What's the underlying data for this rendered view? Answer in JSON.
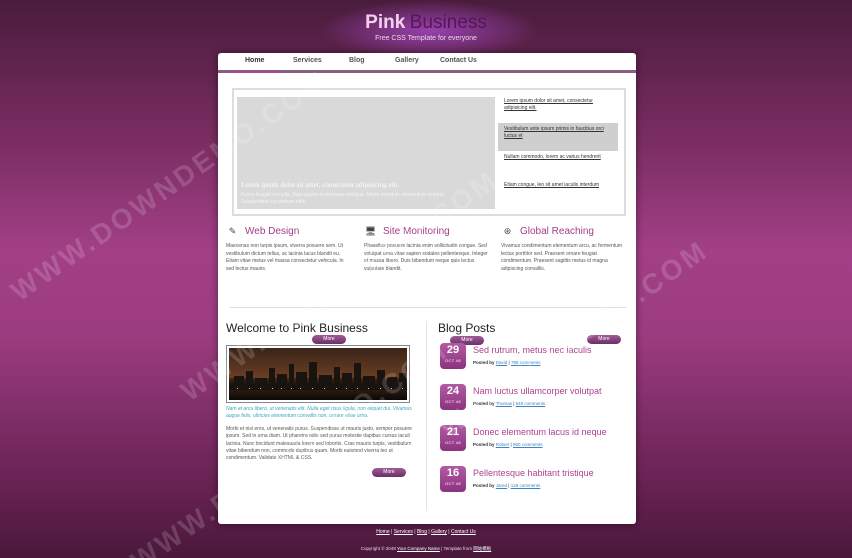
{
  "brand": {
    "part1": "Pink",
    "part2": "Business",
    "tagline": "Free CSS Template for everyone"
  },
  "nav": [
    "Home",
    "Services",
    "Blog",
    "Gallery",
    "Contact Us"
  ],
  "slider": {
    "heading": "Lorem ipsum dolor sit amet, consectetur adipisicing elit.",
    "text": "Fusce feugiat mi nulla. Nam auctor scelerisque tristique. Morbi interdum elementum semper. Suspendisse eu pretium nibh.",
    "links": [
      "Lorem ipsum dolor sit amet, consectetur adipisicing elit.",
      "Vestibulum ante ipsum primis in faucibus orci luctus et",
      "Nullam commodo, lorem ac varius hendrerit",
      "Etiam congue, leo sit amet iaculis interdum"
    ]
  },
  "services": [
    {
      "title": "Web Design",
      "icon": "pencil-icon",
      "text": "Maecenas non turpis ipsum, viverra posuere sem. Ut vestibulum dictum tellus, ac lacinia lacus blandit eu. Etiam vitae metus vel massa consectetur vehicula. In sed lectus mauris."
    },
    {
      "title": "Site Monitoring",
      "icon": "monitor-icon",
      "text": "Phasellus posuere lacinia enim sollicitudin congue. Sed volutpat urna vitae sapien sodales pellentesque. Integer et massa libero. Duis bibendum neque quis lectus vulputate blandit."
    },
    {
      "title": "Global Reaching",
      "icon": "lifebuoy-icon",
      "text": "Vivamus condimentum elementum arcu, ac fermentum lectus porttitor sed. Praesent ornare feugiat condimentum. Praesent sagittis metus id magna adipiscing convallis."
    }
  ],
  "more_label": "More",
  "welcome": {
    "title": "Welcome to Pink Business",
    "caption": "Nam et arcu libero, ut venenatis elit. Nulla eget risus ligula, non aliquet dui. Vivamus augue felis, ultricies elementum convallis non, ornare vitae urna.",
    "body": "Morbi et nisl eros, ut venenatis purus. Suspendisse ut mauris justo, semper posuere ipsum. Sed in urna diam. Ut pharetra odio sed purus molestie dapibus cursus iaculi lacinia. Nunc tincidunt malesuada lorem sed lobortis. Cras mauris turpis, vestibulum vitae bibendum non, commodo dapibus quam. Morbi euismod viverra leo ut condimentum. Validate XHTML & CSS."
  },
  "blog": {
    "title": "Blog Posts",
    "posts": [
      {
        "day": "29",
        "month": "OCT 48",
        "title": "Sed rutrum, metus nec iaculis",
        "author": "David",
        "comments": "788 comments"
      },
      {
        "day": "24",
        "month": "OCT 48",
        "title": "Nam luctus ullamcorper volutpat",
        "author": "Thomas",
        "comments": "548 comments"
      },
      {
        "day": "21",
        "month": "OCT 48",
        "title": "Donec elementum lacus id neque",
        "author": "Robert",
        "comments": "960 comments"
      },
      {
        "day": "16",
        "month": "OCT 48",
        "title": "Pellentesque habitant tristique",
        "author": "Jared",
        "comments": "128 comments"
      }
    ],
    "posted_by": "Posted by",
    "sep": "|"
  },
  "footer": {
    "links": [
      "Home",
      "Services",
      "Blog",
      "Gallery",
      "Contact Us"
    ],
    "copyright": "Copyright © 2048",
    "company": "Your Company Name",
    "template_from": "| Template from",
    "template_site": "网站模板"
  },
  "watermark": "WWW.DOWNDEMO.COM"
}
